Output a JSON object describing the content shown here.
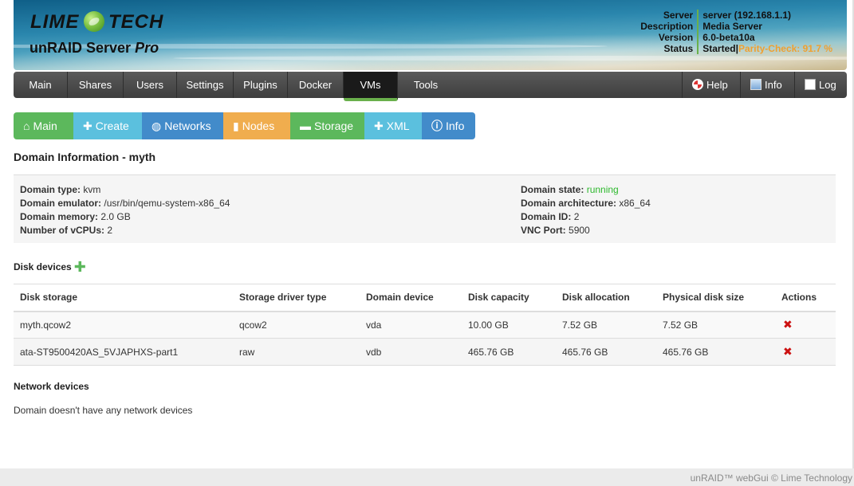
{
  "banner": {
    "logo_left": "LIME",
    "logo_right": "TECH",
    "product": "unRAID Server",
    "edition": "Pro"
  },
  "server_info": {
    "server_label": "Server",
    "server_value": "server (192.168.1.1)",
    "description_label": "Description",
    "description_value": "Media Server",
    "version_label": "Version",
    "version_value": "6.0-beta10a",
    "status_label": "Status",
    "status_value": "Started",
    "status_separator": "|",
    "parity_check": "Parity-Check: 91.7 %",
    "parity_color": "#f0a030"
  },
  "nav": {
    "tabs": [
      {
        "label": "Main"
      },
      {
        "label": "Shares"
      },
      {
        "label": "Users"
      },
      {
        "label": "Settings"
      },
      {
        "label": "Plugins"
      },
      {
        "label": "Docker"
      },
      {
        "label": "VMs"
      },
      {
        "label": "Tools"
      }
    ],
    "active": "VMs",
    "right": {
      "help": "Help",
      "info": "Info",
      "log": "Log"
    }
  },
  "subnav": {
    "main": "Main",
    "create": "Create",
    "networks": "Networks",
    "nodes": "Nodes",
    "storage": "Storage",
    "xml": "XML",
    "info": "Info"
  },
  "domain": {
    "title": "Domain Information - myth",
    "type_label": "Domain type:",
    "type_value": "kvm",
    "emulator_label": "Domain emulator:",
    "emulator_value": "/usr/bin/qemu-system-x86_64",
    "memory_label": "Domain memory:",
    "memory_value": "2.0 GB",
    "vcpus_label": "Number of vCPUs:",
    "vcpus_value": "2",
    "state_label": "Domain state:",
    "state_value": "running",
    "arch_label": "Domain architecture:",
    "arch_value": "x86_64",
    "id_label": "Domain ID:",
    "id_value": "2",
    "vnc_label": "VNC Port:",
    "vnc_value": "5900"
  },
  "disks": {
    "title": "Disk devices",
    "headers": [
      "Disk storage",
      "Storage driver type",
      "Domain device",
      "Disk capacity",
      "Disk allocation",
      "Physical disk size",
      "Actions"
    ],
    "rows": [
      {
        "storage": "myth.qcow2",
        "driver": "qcow2",
        "device": "vda",
        "capacity": "10.00 GB",
        "allocation": "7.52 GB",
        "physical": "7.52 GB"
      },
      {
        "storage": "ata-ST9500420AS_5VJAPHXS-part1",
        "driver": "raw",
        "device": "vdb",
        "capacity": "465.76 GB",
        "allocation": "465.76 GB",
        "physical": "465.76 GB"
      }
    ]
  },
  "network": {
    "title": "Network devices",
    "empty_message": "Domain doesn't have any network devices"
  },
  "footer": {
    "text": "unRAID™ webGui © Lime Technology"
  },
  "colors": {
    "accent_green": "#5cb85c",
    "accent_cyan": "#5bc0de",
    "accent_blue": "#428bca",
    "accent_orange": "#f0ad4e",
    "running": "#2db82d",
    "delete": "#cc1111"
  }
}
